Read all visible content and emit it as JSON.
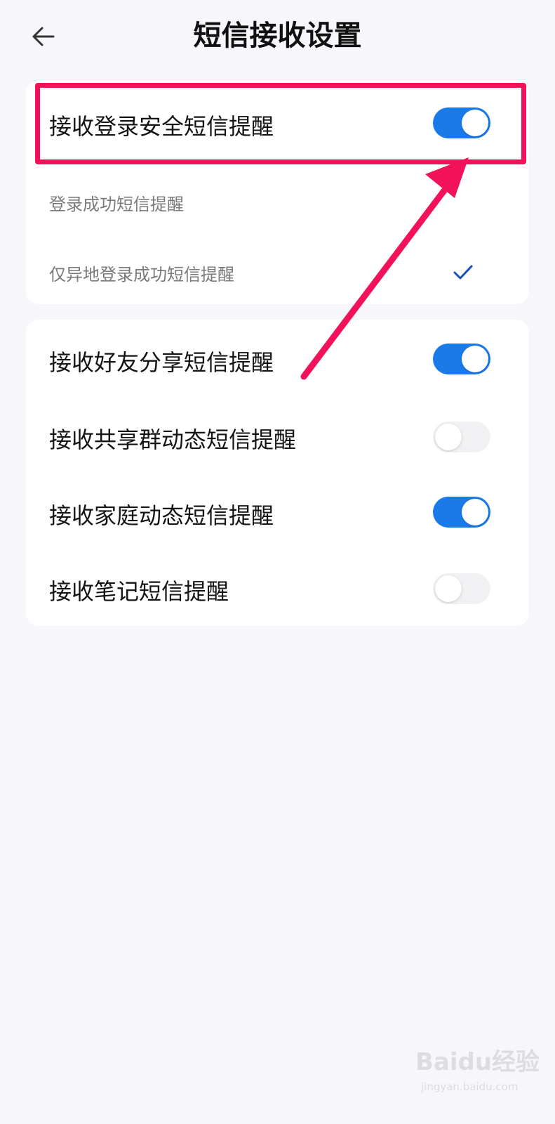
{
  "header": {
    "title": "短信接收设置",
    "back_icon": "arrow-left-icon"
  },
  "login_section": {
    "main": {
      "label": "接收登录安全短信提醒",
      "enabled": true
    },
    "options": [
      {
        "label": "登录成功短信提醒",
        "selected": false
      },
      {
        "label": "仅异地登录成功短信提醒",
        "selected": true
      }
    ]
  },
  "other_settings": [
    {
      "label": "接收好友分享短信提醒",
      "enabled": true
    },
    {
      "label": "接收共享群动态短信提醒",
      "enabled": false
    },
    {
      "label": "接收家庭动态短信提醒",
      "enabled": true
    },
    {
      "label": "接收笔记短信提醒",
      "enabled": false
    }
  ],
  "watermark": {
    "logo": "Baidu经验",
    "url": "jingyan.baidu.com"
  },
  "colors": {
    "accent": "#1a7be8",
    "highlight": "#f2125a",
    "background": "#f7f6fb"
  }
}
